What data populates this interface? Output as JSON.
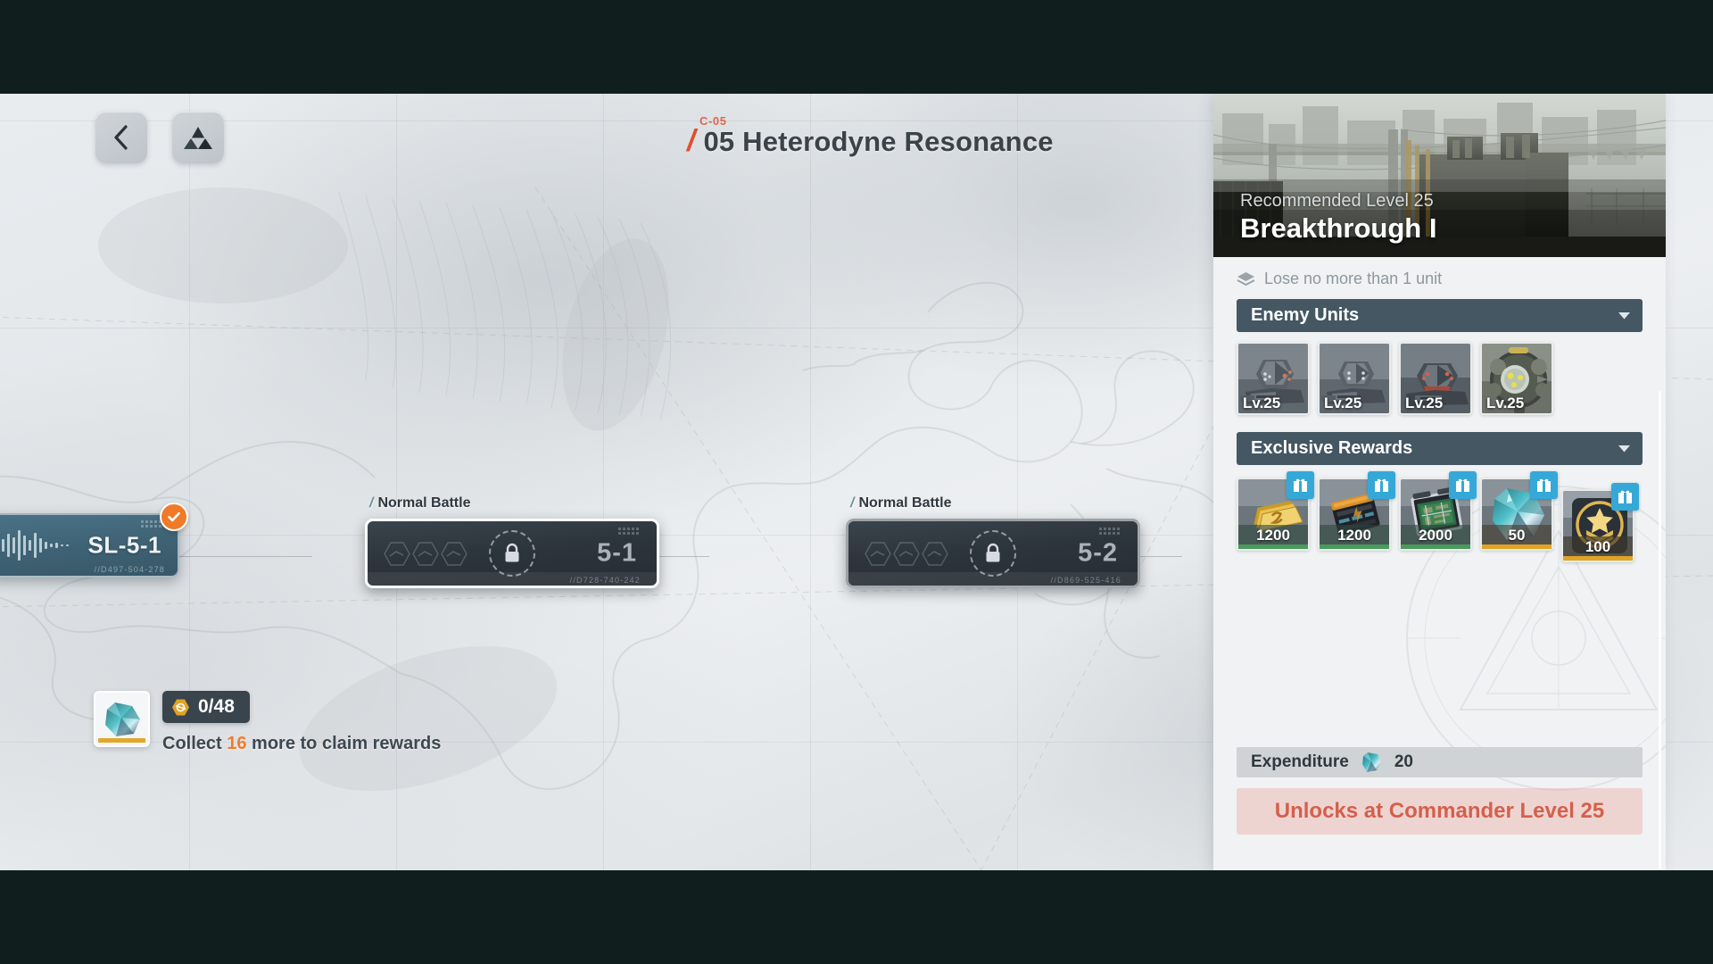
{
  "header": {
    "back_icon": "chevron-left-icon",
    "logo_icon": "prism-logo-icon",
    "chapter_code": "C-05",
    "slash": "/",
    "title": "05 Heterodyne Resonance"
  },
  "map": {
    "nodes": [
      {
        "id": "sl-5-1",
        "type": "special",
        "name": "SL-5-1",
        "serial": "//D497-504-278",
        "cleared": true,
        "icon": "waveform-icon",
        "badge_icon": "check-circle-icon"
      },
      {
        "id": "5-1",
        "type": "normal",
        "label_prefix": "/",
        "label": "Normal Battle",
        "number": "5-1",
        "serial": "//D728-740-242",
        "locked": true,
        "lock_icon": "lock-icon",
        "stars": 3,
        "stars_earned": 0
      },
      {
        "id": "5-2",
        "type": "normal",
        "label_prefix": "/",
        "label": "Normal Battle",
        "number": "5-2",
        "serial": "//D869-525-416",
        "locked": true,
        "lock_icon": "lock-icon",
        "stars": 3,
        "stars_earned": 0
      }
    ]
  },
  "collect": {
    "item_icon": "crystal-shard-icon",
    "token_icon": "hex-token-icon",
    "count_text": "0/48",
    "message_prefix": "Collect ",
    "message_number": "16",
    "message_suffix": " more to claim rewards"
  },
  "panel": {
    "banner": {
      "recommended": "Recommended Level 25",
      "title": "Breakthrough I"
    },
    "condition": {
      "icon": "shield-stack-icon",
      "text": "Lose no more than 1 unit"
    },
    "enemy_section": {
      "title": "Enemy Units",
      "chevron_icon": "chevron-down-icon",
      "units": [
        {
          "level": "Lv.25",
          "type": "soldier-rifle"
        },
        {
          "level": "Lv.25",
          "type": "soldier-rifle"
        },
        {
          "level": "Lv.25",
          "type": "soldier-heavy"
        },
        {
          "level": "Lv.25",
          "type": "drone-sphere"
        }
      ]
    },
    "rewards_section": {
      "title": "Exclusive Rewards",
      "chevron_icon": "chevron-down-icon",
      "items": [
        {
          "qty": "1200",
          "kind": "gold-bar",
          "rarity_color": "#4a9a5e",
          "gift_icon": "gift-icon"
        },
        {
          "qty": "1200",
          "kind": "battery-pack",
          "rarity_color": "#4a9a5e",
          "gift_icon": "gift-icon"
        },
        {
          "qty": "2000",
          "kind": "circuit-board",
          "rarity_color": "#4a9a5e",
          "gift_icon": "gift-icon"
        },
        {
          "qty": "50",
          "kind": "crystal-shard",
          "rarity_color": "#e0a424",
          "gift_icon": "gift-icon"
        },
        {
          "qty": "100",
          "kind": "rank-medal",
          "rarity_color": "#e0a424",
          "gift_icon": "gift-icon"
        }
      ]
    },
    "expenditure": {
      "label": "Expenditure",
      "icon": "crystal-shard-icon",
      "value": "20"
    },
    "locked_notice": "Unlocks at Commander Level 25"
  },
  "colors": {
    "accent_orange": "#e0512d",
    "section_header": "#445763",
    "gift_blue": "#35a8d8",
    "locked_red": "#d4604c",
    "sl_teal": "#3f6375"
  }
}
